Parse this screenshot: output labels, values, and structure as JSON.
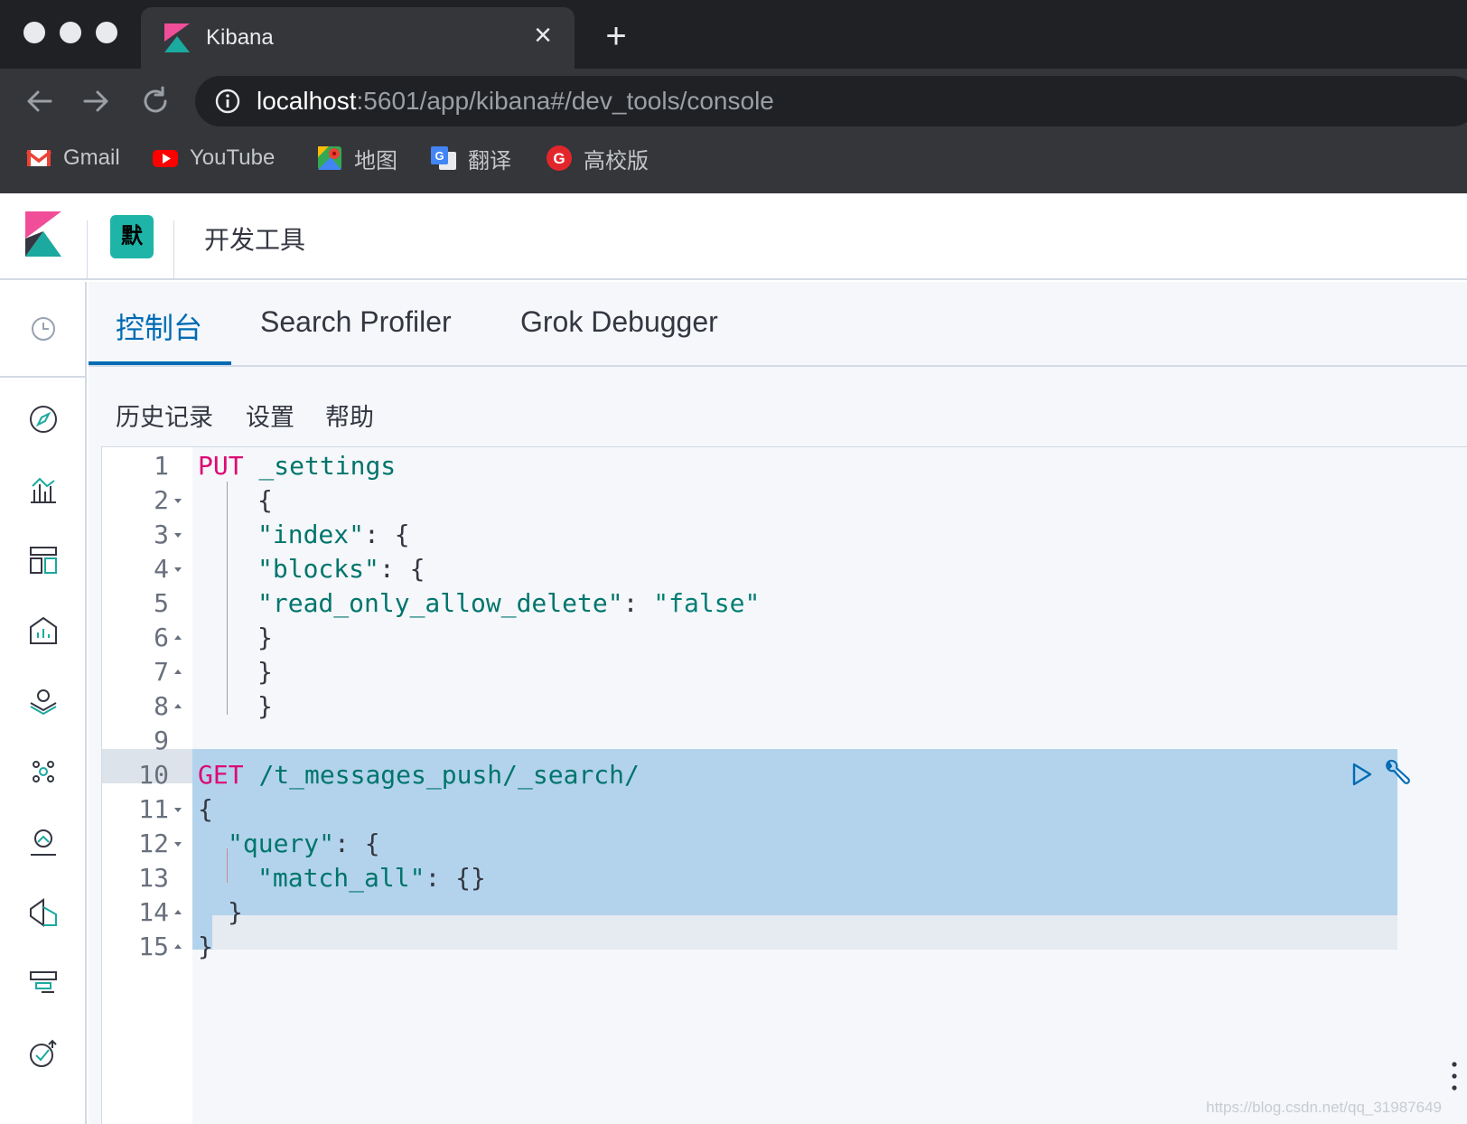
{
  "browser": {
    "tab_title": "Kibana",
    "close_symbol": "×",
    "new_tab_symbol": "+",
    "url_host": "localhost",
    "url_rest": ":5601/app/kibana#/dev_tools/console",
    "bookmarks": [
      {
        "label": "Gmail",
        "icon": "gmail-icon"
      },
      {
        "label": "YouTube",
        "icon": "youtube-icon"
      },
      {
        "label": "地图",
        "icon": "maps-icon"
      },
      {
        "label": "翻译",
        "icon": "translate-icon"
      },
      {
        "label": "高校版",
        "icon": "g-icon"
      }
    ]
  },
  "kibana_header": {
    "space_avatar": "默",
    "app_title": "开发工具"
  },
  "dev_tabs": [
    {
      "label": "控制台",
      "active": true
    },
    {
      "label": "Search Profiler",
      "active": false
    },
    {
      "label": "Grok Debugger",
      "active": false
    }
  ],
  "console_menu": [
    "历史记录",
    "设置",
    "帮助"
  ],
  "editor": {
    "line_numbers": [
      "1",
      "2",
      "3",
      "4",
      "5",
      "6",
      "7",
      "8",
      "9",
      "10",
      "11",
      "12",
      "13",
      "14",
      "15"
    ],
    "lines": {
      "l1_method": "PUT",
      "l1_path": "_settings",
      "l2": "{",
      "l3_key": "\"index\"",
      "l3_rest": ": {",
      "l4_key": "\"blocks\"",
      "l4_rest": ": {",
      "l5_key": "\"read_only_allow_delete\"",
      "l5_colon": ": ",
      "l5_value": "\"false\"",
      "l6": "}",
      "l7": "}",
      "l8": "}",
      "l10_method": "GET",
      "l10_path": "/t_messages_push/_search/",
      "l11": "{",
      "l12_key": "\"query\"",
      "l12_rest": ": {",
      "l13_key": "\"match_all\"",
      "l13_rest": ": {}",
      "l14": "}",
      "l15": "}"
    }
  },
  "watermark": "https://blog.csdn.net/qq_31987649",
  "colors": {
    "accent": "#006bb4",
    "method": "#dd0a73",
    "string": "#00756c",
    "selection": "#b3d3ec"
  }
}
